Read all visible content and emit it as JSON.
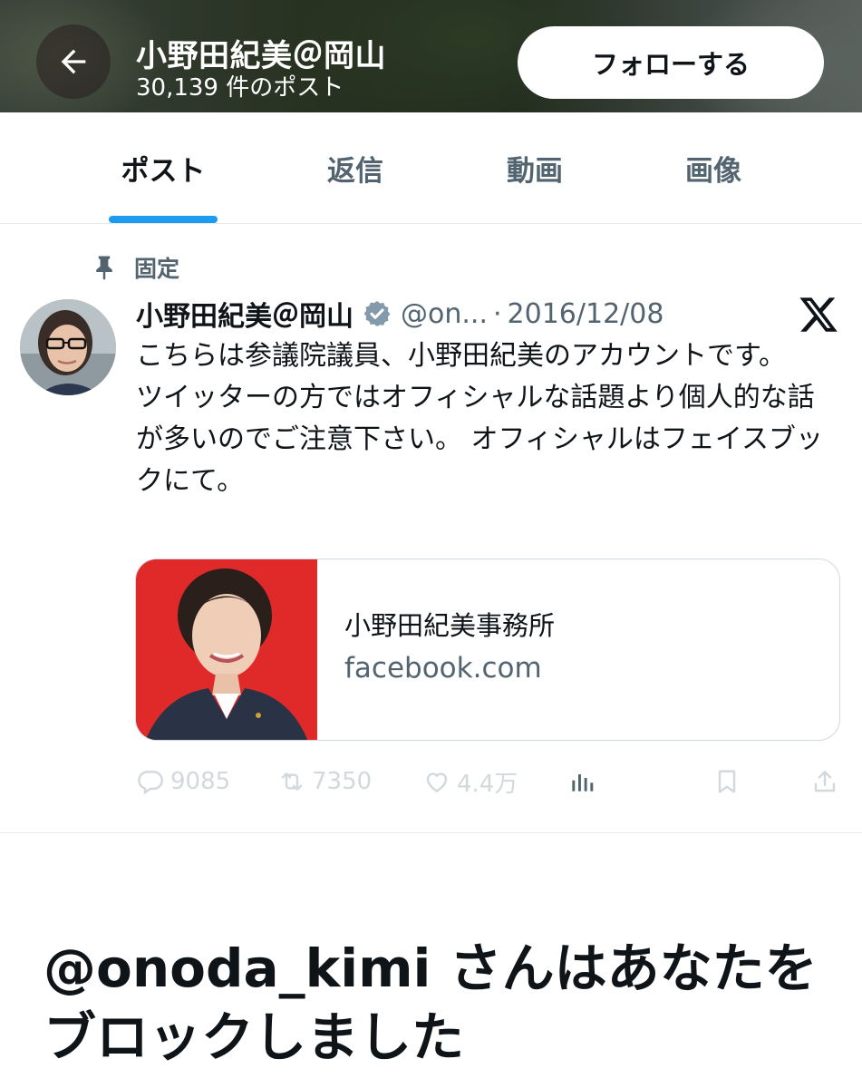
{
  "header": {
    "title": "小野田紀美＠岡山",
    "post_count": "30,139 件のポスト",
    "follow_label": "フォローする",
    "back_icon": "arrow-left-icon"
  },
  "tabs": [
    {
      "label": "ポスト",
      "active": true
    },
    {
      "label": "返信",
      "active": false
    },
    {
      "label": "動画",
      "active": false
    },
    {
      "label": "画像",
      "active": false
    }
  ],
  "pinned_post": {
    "pinned_label": "固定",
    "author_name": "小野田紀美＠岡山",
    "handle": "@on...",
    "separator": "·",
    "date": "2016/12/08",
    "text_lines": [
      "こちらは参議院議員、小野田紀美のアカウントです。",
      "ツイッターの方ではオフィシャルな話題より個人的な話が多いのでご注意下さい。 オフィシャルはフェイスブックにて。"
    ],
    "link_card": {
      "title": "小野田紀美事務所",
      "domain": "facebook.com"
    },
    "actions": {
      "replies": "9085",
      "reposts": "7350",
      "likes": "4.4万"
    }
  },
  "blocked_message": "@onoda_kimi さんはあなたをブロックしました",
  "colors": {
    "accent": "#1d9bf0",
    "text_primary": "#0f1419",
    "text_secondary": "#536471",
    "card_thumb_red": "#e02a2a"
  }
}
